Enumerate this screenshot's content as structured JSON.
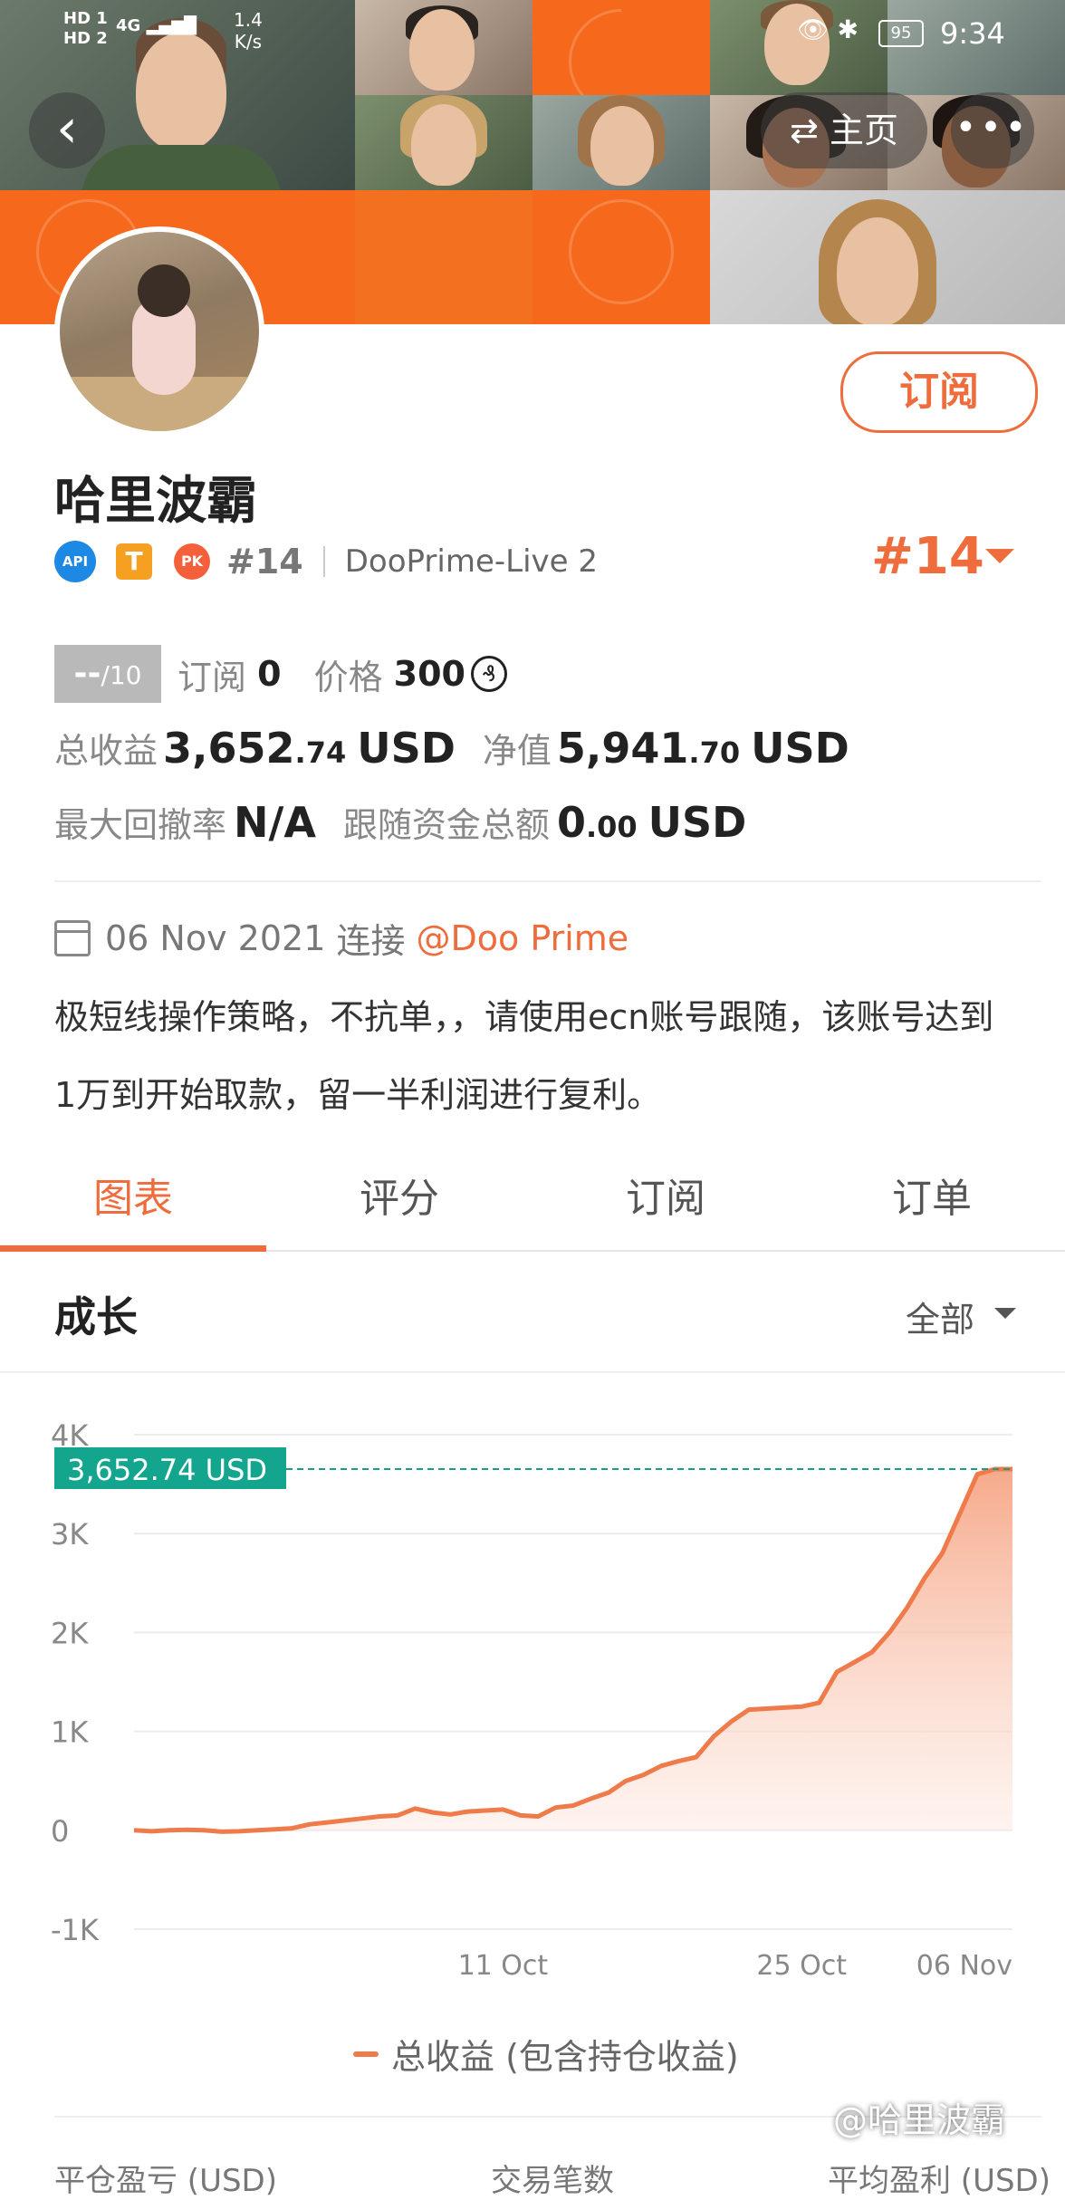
{
  "status_bar": {
    "sim1": "HD 1",
    "sim2": "HD 2",
    "network": "4G",
    "speed": "1.4",
    "speed_unit": "K/s",
    "battery": "95",
    "time": "9:34"
  },
  "header": {
    "home_label": "主页"
  },
  "profile": {
    "name": "哈里波霸",
    "subscribe_label": "订阅",
    "badge_api": "API",
    "badge_t": "T",
    "badge_pk": "PK",
    "rank_small": "#14",
    "server": "DooPrime-Live 2",
    "rank_big": "#14"
  },
  "stats": {
    "score": "--",
    "score_max": "/10",
    "subscribe_label": "订阅",
    "subscribe_count": "0",
    "price_label": "价格",
    "price_value": "300",
    "price_icon": "₰",
    "total_profit_label": "总收益",
    "total_profit_int": "3,652",
    "total_profit_dec": ".74",
    "total_profit_unit": "USD",
    "equity_label": "净值",
    "equity_int": "5,941",
    "equity_dec": ".70",
    "equity_unit": "USD",
    "max_drawdown_label": "最大回撤率",
    "max_drawdown_value": "N/A",
    "follow_total_label": "跟随资金总额",
    "follow_total_int": "0",
    "follow_total_dec": ".00",
    "follow_total_unit": "USD"
  },
  "info": {
    "date": "06 Nov 2021",
    "connect_label": "连接",
    "broker_link": "@Doo Prime",
    "description": "极短线操作策略，不抗单，，请使用ecn账号跟随，该账号达到1万到开始取款，留一半利润进行复利。"
  },
  "tabs": [
    {
      "label": "图表",
      "active": true
    },
    {
      "label": "评分",
      "active": false
    },
    {
      "label": "订阅",
      "active": false
    },
    {
      "label": "订单",
      "active": false
    }
  ],
  "section": {
    "title": "成长",
    "range": "全部"
  },
  "chart_data": {
    "type": "area",
    "title": "",
    "current_label": "3,652.74 USD",
    "y_ticks": [
      "4K",
      "3K",
      "2K",
      "1K",
      "0",
      "-1K"
    ],
    "ylim": [
      -1000,
      4000
    ],
    "x_ticks": [
      "11 Oct",
      "25 Oct",
      "06 Nov"
    ],
    "legend": "总收益 (包含持仓收益)",
    "color": "#ef7a4a",
    "x": [
      0,
      2,
      4,
      6,
      8,
      10,
      12,
      14,
      16,
      18,
      20,
      22,
      24,
      26,
      28,
      30,
      32,
      34,
      36,
      38,
      40,
      42,
      44,
      46,
      48,
      50,
      52,
      54,
      56,
      58,
      60,
      62,
      64,
      66,
      68,
      70,
      72,
      74,
      76,
      78,
      80,
      82,
      84,
      86,
      88,
      90,
      92,
      94,
      96,
      98,
      100
    ],
    "y": [
      0,
      -10,
      0,
      5,
      0,
      -15,
      -10,
      0,
      10,
      20,
      60,
      80,
      100,
      120,
      140,
      150,
      220,
      180,
      160,
      190,
      200,
      210,
      150,
      140,
      230,
      250,
      320,
      380,
      500,
      560,
      650,
      700,
      740,
      950,
      1100,
      1220,
      1230,
      1240,
      1250,
      1290,
      1600,
      1700,
      1800,
      2000,
      2250,
      2550,
      2800,
      3200,
      3600,
      3652,
      3652
    ]
  },
  "bottom_labels": [
    "平仓盈亏 (USD)",
    "交易笔数",
    "平均盈利 (USD)"
  ],
  "watermark": "@哈里波霸"
}
